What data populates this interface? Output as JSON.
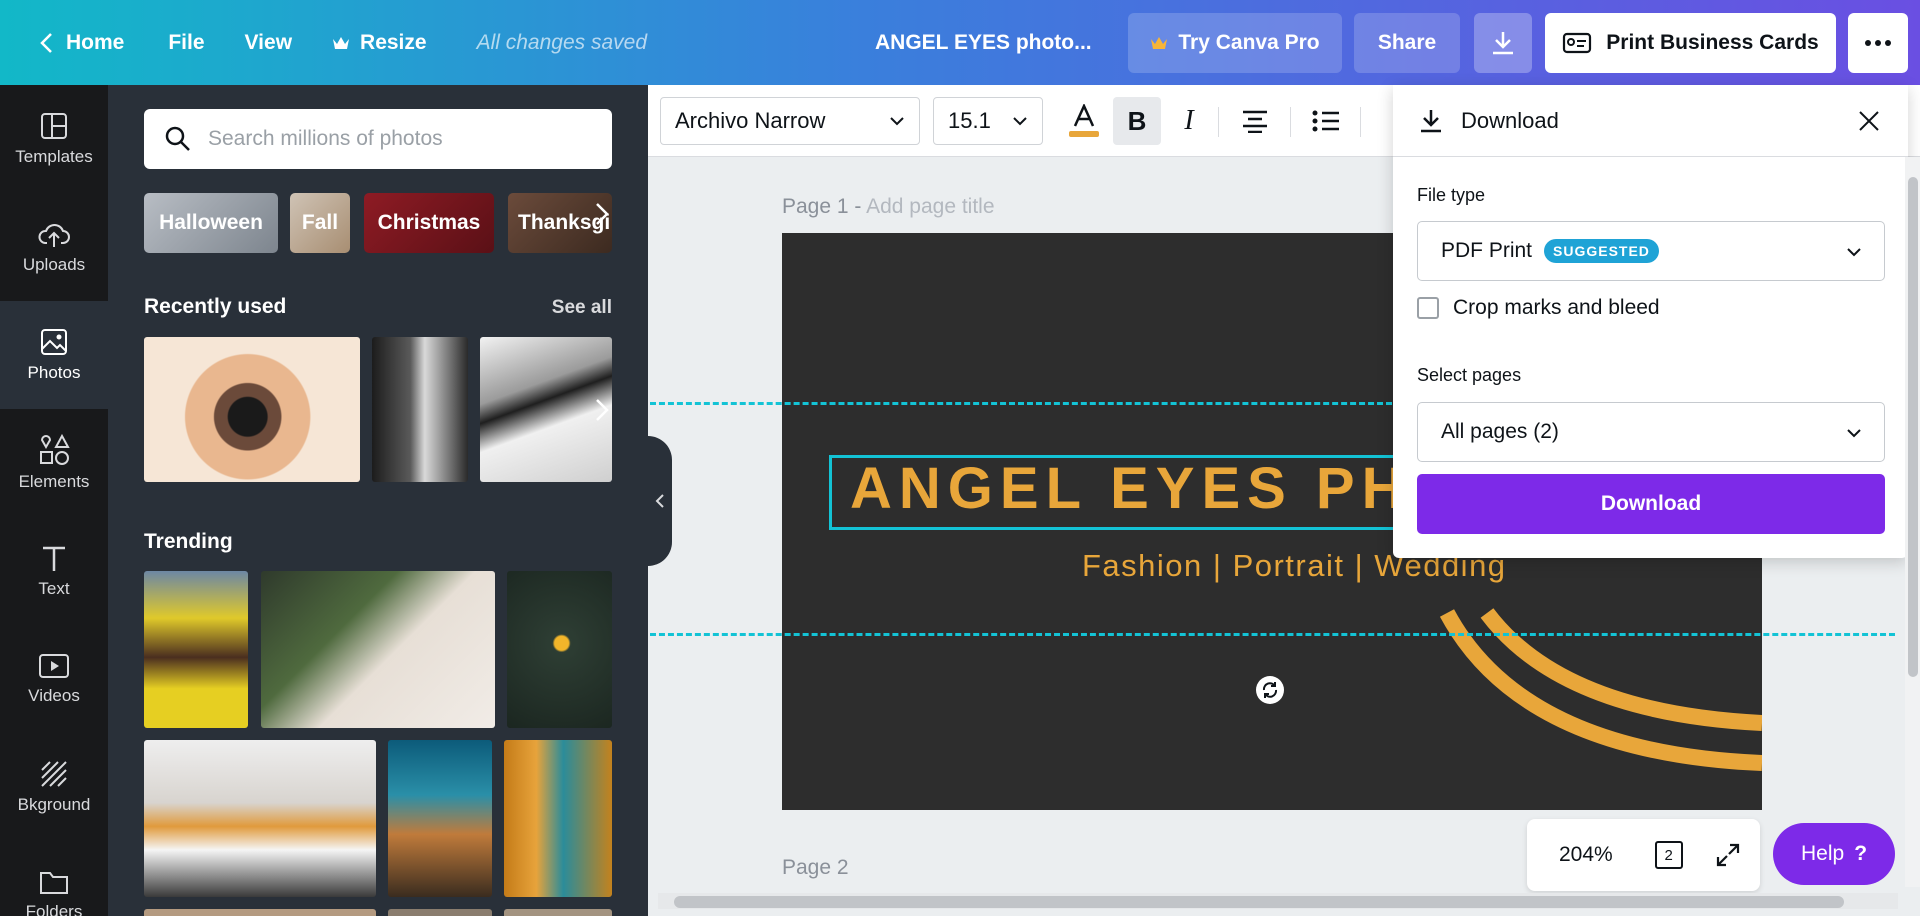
{
  "topbar": {
    "home": "Home",
    "file": "File",
    "view": "View",
    "resize": "Resize",
    "saved": "All changes saved",
    "doc_title": "ANGEL EYES photo...",
    "try_pro": "Try Canva Pro",
    "share": "Share",
    "print": "Print Business Cards",
    "colors": {
      "gradient_start": "#12b8c8",
      "gradient_end": "#6a4fe2"
    }
  },
  "nav": {
    "items": [
      {
        "label": "Templates",
        "icon": "templates-icon"
      },
      {
        "label": "Uploads",
        "icon": "upload-cloud-icon"
      },
      {
        "label": "Photos",
        "icon": "photo-icon",
        "active": true
      },
      {
        "label": "Elements",
        "icon": "shapes-icon"
      },
      {
        "label": "Text",
        "icon": "text-t-icon"
      },
      {
        "label": "Videos",
        "icon": "video-icon"
      },
      {
        "label": "Bkground",
        "icon": "hatch-icon"
      },
      {
        "label": "Folders",
        "icon": "folder-icon"
      }
    ]
  },
  "panel": {
    "search_placeholder": "Search millions of photos",
    "chips": [
      "Halloween",
      "Fall",
      "Christmas",
      "Thanksgi"
    ],
    "recent_heading": "Recently used",
    "see_all": "See all",
    "trending_heading": "Trending"
  },
  "toolbar": {
    "font": "Archivo Narrow",
    "size": "15.1",
    "bold": "B",
    "italic": "I",
    "text_color": "#e8a63a"
  },
  "canvas": {
    "page1_label": "Page 1 -",
    "page1_placeholder": "Add page title",
    "page2_label": "Page 2",
    "card_title": "ANGEL EYES PHOTOGRAPHY",
    "card_subtitle": "Fashion | Portrait | Wedding",
    "accent": "#e8a63a",
    "card_bg": "#2d2d2d"
  },
  "download": {
    "title": "Download",
    "file_type_label": "File type",
    "file_type_value": "PDF Print",
    "badge": "SUGGESTED",
    "crop_label": "Crop marks and bleed",
    "crop_checked": false,
    "pages_label": "Select pages",
    "pages_value": "All pages (2)",
    "button": "Download",
    "button_color": "#7d2ae8"
  },
  "bottom": {
    "zoom": "204%",
    "page_count": "2",
    "help": "Help",
    "help_q": "?"
  }
}
